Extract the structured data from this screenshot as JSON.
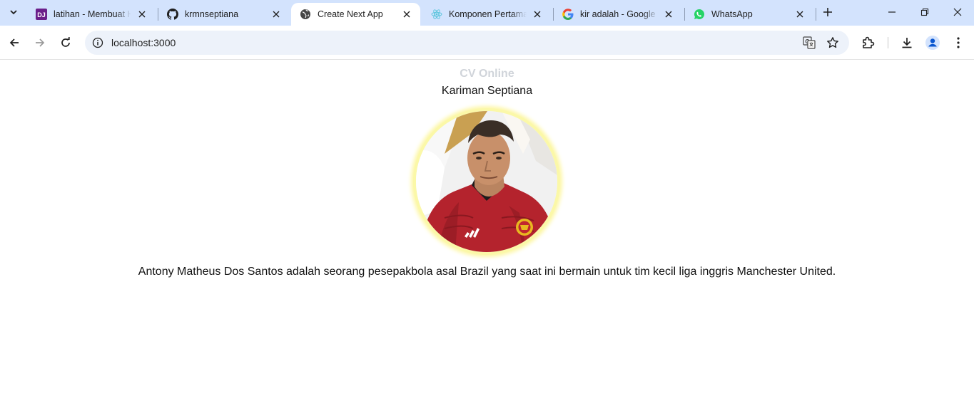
{
  "browser": {
    "tabs": [
      {
        "title": "latihan - Membuat He",
        "favicon": "dj-icon",
        "active": false
      },
      {
        "title": "krmnseptiana",
        "favicon": "github-icon",
        "active": false
      },
      {
        "title": "Create Next App",
        "favicon": "globe-icon",
        "active": true
      },
      {
        "title": "Komponen Pertama A",
        "favicon": "react-icon",
        "active": false
      },
      {
        "title": "kir adalah - Google S",
        "favicon": "google-icon",
        "active": false
      },
      {
        "title": "WhatsApp",
        "favicon": "whatsapp-icon",
        "active": false
      }
    ],
    "favicon_dj_text": "DJ",
    "address": "localhost:3000"
  },
  "page": {
    "heading": "CV Online",
    "name": "Kariman Septiana",
    "description": "Antony Matheus Dos Santos adalah seorang pesepakbola asal Brazil yang saat ini bermain untuk tim kecil liga inggris Manchester United."
  },
  "colors": {
    "tabstrip": "#d3e3fd",
    "omnibox": "#edf2fa",
    "heading": "#d0d4da",
    "photo_ring": "#fbf8a8",
    "jersey": "#b4232d"
  }
}
